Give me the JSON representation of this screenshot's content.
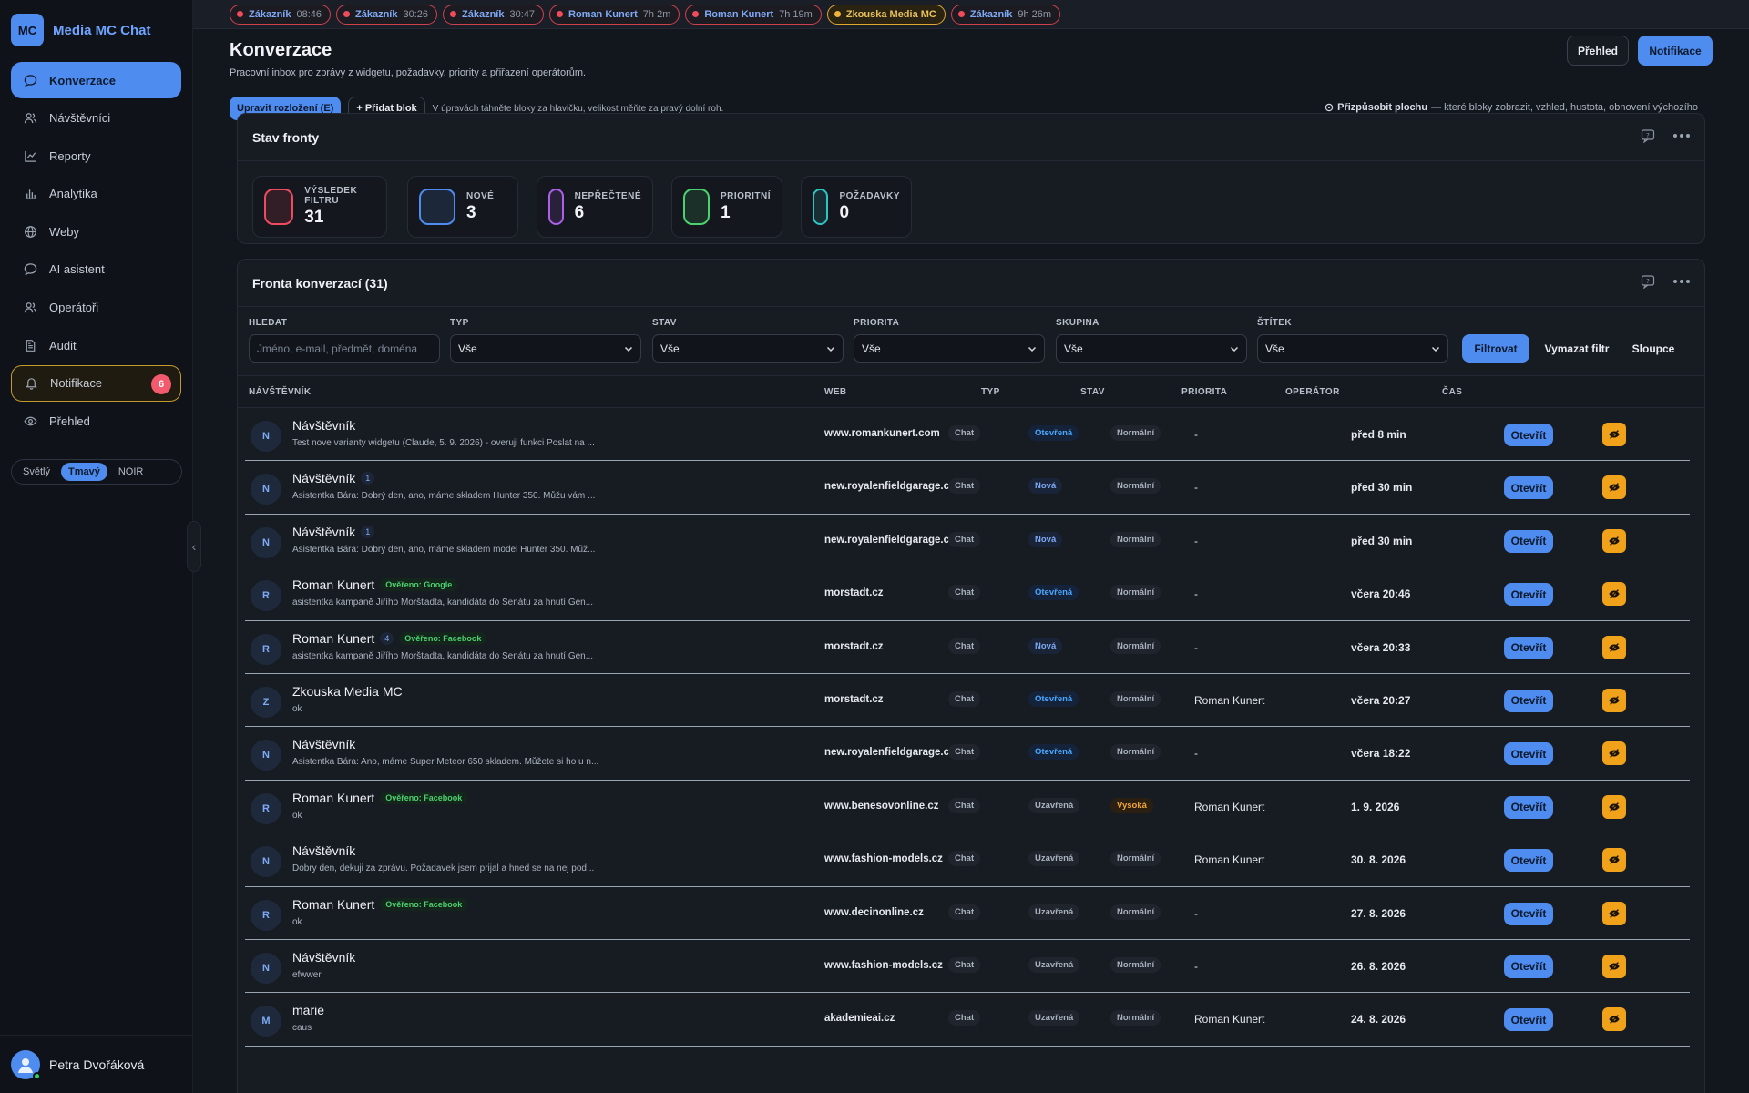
{
  "brand": {
    "logo": "MC",
    "name": "Media MC Chat"
  },
  "nav": [
    {
      "label": "Konverzace",
      "icon": "chat-bubble-icon",
      "active": true
    },
    {
      "label": "Návštěvníci",
      "icon": "users-icon"
    },
    {
      "label": "Reporty",
      "icon": "line-chart-icon"
    },
    {
      "label": "Analytika",
      "icon": "bar-chart-icon"
    },
    {
      "label": "Weby",
      "icon": "globe-icon"
    },
    {
      "label": "AI asistent",
      "icon": "chat-bubble-icon"
    },
    {
      "label": "Operátoři",
      "icon": "users-icon"
    },
    {
      "label": "Audit",
      "icon": "document-icon"
    },
    {
      "label": "Notifikace",
      "icon": "bell-icon",
      "badge": "6"
    },
    {
      "label": "Přehled",
      "icon": "eye-icon"
    }
  ],
  "theme": {
    "options": [
      "Světlý",
      "Tmavý",
      "NOIR"
    ],
    "selected": "Tmavý"
  },
  "user": {
    "name": "Petra Dvořáková"
  },
  "chips": [
    {
      "name": "Zákazník",
      "time": "08:46"
    },
    {
      "name": "Zákazník",
      "time": "30:26"
    },
    {
      "name": "Zákazník",
      "time": "30:47"
    },
    {
      "name": "Roman Kunert",
      "time": "7h 2m"
    },
    {
      "name": "Roman Kunert",
      "time": "7h 19m"
    },
    {
      "name": "Zkouska Media MC",
      "time": "",
      "active": true
    },
    {
      "name": "Zákazník",
      "time": "9h 26m"
    }
  ],
  "header": {
    "title": "Konverzace",
    "subtitle": "Pracovní inbox pro zprávy z widgetu, požadavky, priority a přiřazení operátorům.",
    "btn_overview": "Přehled",
    "btn_notifications": "Notifikace",
    "btn_layout": "Upravit rozložení (E)",
    "btn_add_block": "+ Přidat blok",
    "hint": "V úpravách táhněte bloky za hlavičku, velikost měňte za pravý dolní roh.",
    "customize_label": "Přizpůsobit plochu",
    "customize_desc": "— které bloky zobrazit, vzhled, hustota, obnovení výchozího"
  },
  "queue_status": {
    "title": "Stav fronty",
    "stats": [
      {
        "label": "VÝSLEDEK FILTRU",
        "value": "31",
        "color": "#ef4a5f"
      },
      {
        "label": "NOVÉ",
        "value": "3",
        "color": "#4f8cf0"
      },
      {
        "label": "NEPŘEČTENÉ",
        "value": "6",
        "color": "#b060e8"
      },
      {
        "label": "PRIORITNÍ",
        "value": "1",
        "color": "#4bd16e"
      },
      {
        "label": "POŽADAVKY",
        "value": "0",
        "color": "#2fc4c4"
      }
    ]
  },
  "queue": {
    "title": "Fronta konverzací (31)",
    "filters": {
      "search_label": "HLEDAT",
      "search_placeholder": "Jméno, e-mail, předmět, doména",
      "type_label": "TYP",
      "type_value": "Vše",
      "state_label": "STAV",
      "state_value": "Vše",
      "priority_label": "PRIORITA",
      "priority_value": "Vše",
      "group_label": "SKUPINA",
      "group_value": "Vše",
      "tag_label": "ŠTÍTEK",
      "tag_value": "Vše",
      "btn_filter": "Filtrovat",
      "btn_clear": "Vymazat filtr",
      "btn_columns": "Sloupce"
    },
    "columns": {
      "visitor": "NÁVŠTĚVNÍK",
      "web": "WEB",
      "type": "TYP",
      "state": "STAV",
      "priority": "PRIORITA",
      "operator": "OPERÁTOR",
      "time": "ČAS"
    },
    "open_label": "Otevřít",
    "rows": [
      {
        "initial": "N",
        "name": "Návštěvník",
        "unread": "",
        "verified": "",
        "msg": "Test nove varianty widgetu (Claude, 5. 9. 2026) - overuji funkci Poslat na ...",
        "web": "www.romankunert.com",
        "type": "Chat",
        "state": "Otevřená",
        "state_kind": "open",
        "priority": "Normální",
        "prio_kind": "normal",
        "operator": "-",
        "time": "před 8 min"
      },
      {
        "initial": "N",
        "name": "Návštěvník",
        "unread": "1",
        "verified": "",
        "msg": "Asistentka Bára: Dobrý den, ano, máme skladem Hunter 350. Můžu vám ...",
        "web": "new.royalenfieldgarage.cz",
        "type": "Chat",
        "state": "Nová",
        "state_kind": "new",
        "priority": "Normální",
        "prio_kind": "normal",
        "operator": "-",
        "time": "před 30 min"
      },
      {
        "initial": "N",
        "name": "Návštěvník",
        "unread": "1",
        "verified": "",
        "msg": "Asistentka Bára: Dobrý den, ano, máme skladem model Hunter 350. Můž...",
        "web": "new.royalenfieldgarage.cz",
        "type": "Chat",
        "state": "Nová",
        "state_kind": "new",
        "priority": "Normální",
        "prio_kind": "normal",
        "operator": "-",
        "time": "před 30 min"
      },
      {
        "initial": "R",
        "name": "Roman Kunert",
        "unread": "",
        "verified": "Ověřeno: Google",
        "msg": "asistentka kampaně Jiřího Moršťadta, kandidáta do Senátu za hnutí Gen...",
        "web": "morstadt.cz",
        "type": "Chat",
        "state": "Otevřená",
        "state_kind": "open",
        "priority": "Normální",
        "prio_kind": "normal",
        "operator": "-",
        "time": "včera 20:46"
      },
      {
        "initial": "R",
        "name": "Roman Kunert",
        "unread": "4",
        "verified": "Ověřeno: Facebook",
        "msg": "asistentka kampaně Jiřího Moršťadta, kandidáta do Senátu za hnutí Gen...",
        "web": "morstadt.cz",
        "type": "Chat",
        "state": "Nová",
        "state_kind": "new",
        "priority": "Normální",
        "prio_kind": "normal",
        "operator": "-",
        "time": "včera 20:33"
      },
      {
        "initial": "Z",
        "name": "Zkouska Media MC",
        "unread": "",
        "verified": "",
        "msg": "ok",
        "web": "morstadt.cz",
        "type": "Chat",
        "state": "Otevřená",
        "state_kind": "open",
        "priority": "Normální",
        "prio_kind": "normal",
        "operator": "Roman Kunert",
        "time": "včera 20:27"
      },
      {
        "initial": "N",
        "name": "Návštěvník",
        "unread": "",
        "verified": "",
        "msg": "Asistentka Bára: Ano, máme Super Meteor 650 skladem. Můžete si ho u n...",
        "web": "new.royalenfieldgarage.cz",
        "type": "Chat",
        "state": "Otevřená",
        "state_kind": "open",
        "priority": "Normální",
        "prio_kind": "normal",
        "operator": "-",
        "time": "včera 18:22"
      },
      {
        "initial": "R",
        "name": "Roman Kunert",
        "unread": "",
        "verified": "Ověřeno: Facebook",
        "msg": "ok",
        "web": "www.benesovonline.cz",
        "type": "Chat",
        "state": "Uzavřená",
        "state_kind": "closed",
        "priority": "Vysoká",
        "prio_kind": "high",
        "operator": "Roman Kunert",
        "time": "1. 9. 2026"
      },
      {
        "initial": "N",
        "name": "Návštěvník",
        "unread": "",
        "verified": "",
        "msg": "Dobry den, dekuji za zprávu. Požadavek jsem prijal a hned se na nej pod...",
        "web": "www.fashion-models.cz",
        "type": "Chat",
        "state": "Uzavřená",
        "state_kind": "closed",
        "priority": "Normální",
        "prio_kind": "normal",
        "operator": "Roman Kunert",
        "time": "30. 8. 2026"
      },
      {
        "initial": "R",
        "name": "Roman Kunert",
        "unread": "",
        "verified": "Ověřeno: Facebook",
        "msg": "ok",
        "web": "www.decinonline.cz",
        "type": "Chat",
        "state": "Uzavřená",
        "state_kind": "closed",
        "priority": "Normální",
        "prio_kind": "normal",
        "operator": "-",
        "time": "27. 8. 2026"
      },
      {
        "initial": "N",
        "name": "Návštěvník",
        "unread": "",
        "verified": "",
        "msg": "efwwer",
        "web": "www.fashion-models.cz",
        "type": "Chat",
        "state": "Uzavřená",
        "state_kind": "closed",
        "priority": "Normální",
        "prio_kind": "normal",
        "operator": "-",
        "time": "26. 8. 2026"
      },
      {
        "initial": "M",
        "name": "marie",
        "unread": "",
        "verified": "",
        "msg": "caus",
        "web": "akademieai.cz",
        "type": "Chat",
        "state": "Uzavřená",
        "state_kind": "closed",
        "priority": "Normální",
        "prio_kind": "normal",
        "operator": "Roman Kunert",
        "time": "24. 8. 2026"
      }
    ]
  }
}
